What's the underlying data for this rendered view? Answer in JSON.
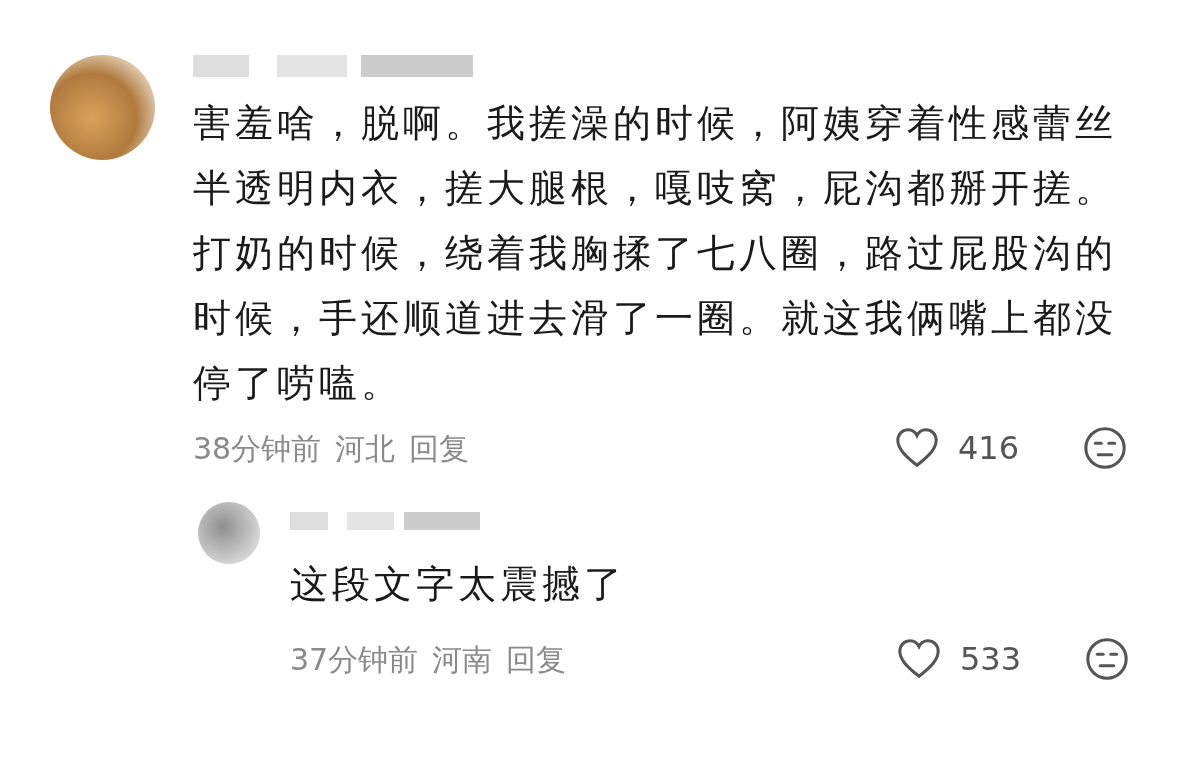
{
  "comments": [
    {
      "text": "害羞啥，脱啊。我搓澡的时候，阿姨穿着性感蕾丝半透明内衣，搓大腿根，嘎吱窝，屁沟都掰开搓。打奶的时候，绕着我胸揉了七八圈，路过屁股沟的时候，手还顺道进去滑了一圈。就这我俩嘴上都没停了唠嗑。",
      "time": "38分钟前",
      "location": "河北",
      "reply": "回复",
      "likes": "416",
      "kind": "top"
    },
    {
      "text": "这段文字太震撼了",
      "time": "37分钟前",
      "location": "河南",
      "reply": "回复",
      "likes": "533",
      "kind": "reply"
    }
  ]
}
